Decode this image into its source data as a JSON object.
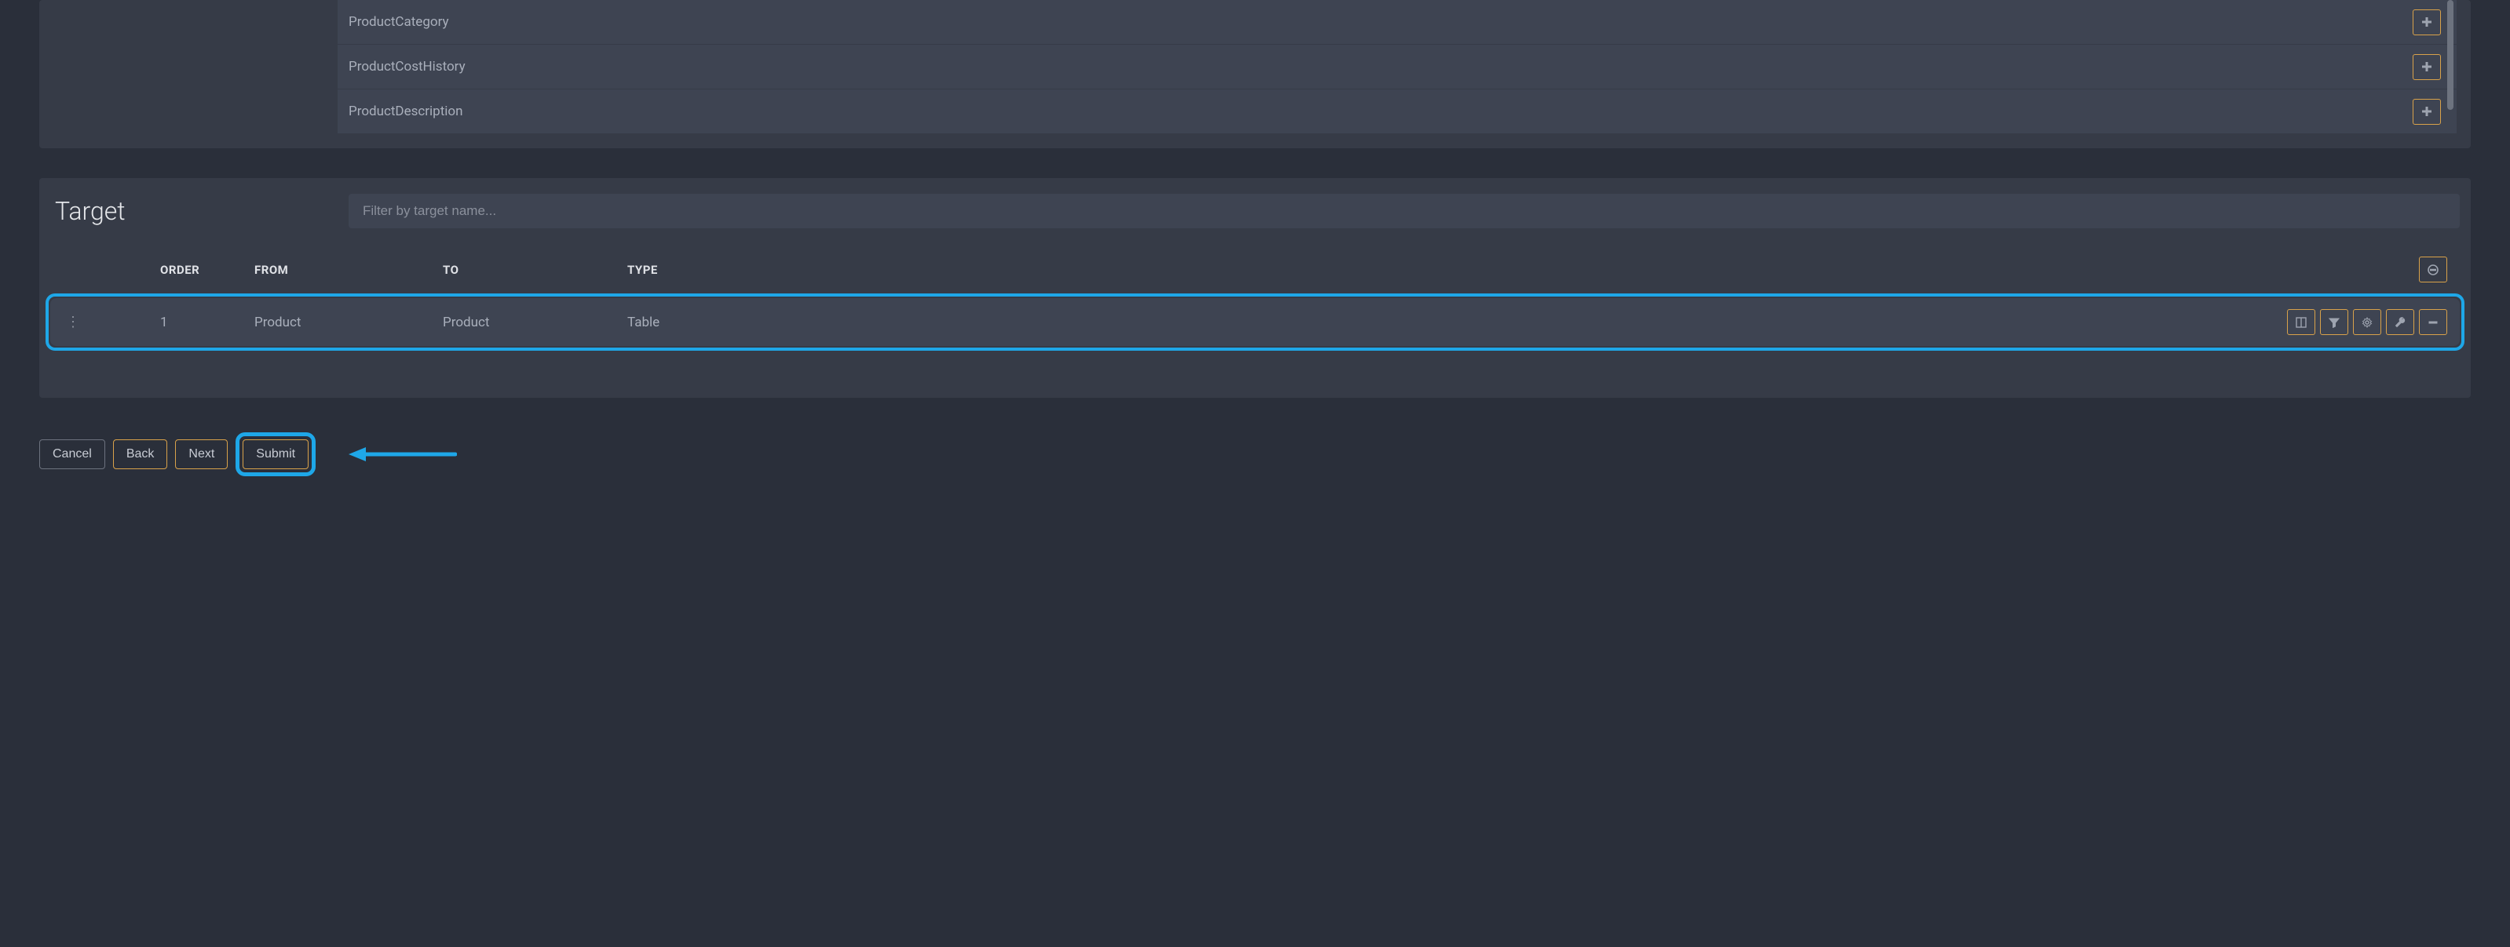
{
  "source": {
    "items": [
      {
        "label": "ProductCategory"
      },
      {
        "label": "ProductCostHistory"
      },
      {
        "label": "ProductDescription"
      }
    ]
  },
  "target": {
    "title": "Target",
    "filter_placeholder": "Filter by target name...",
    "columns": {
      "order": "ORDER",
      "from": "FROM",
      "to": "TO",
      "type": "TYPE"
    },
    "rows": [
      {
        "order": "1",
        "from": "Product",
        "to": "Product",
        "type": "Table"
      }
    ]
  },
  "footer": {
    "cancel": "Cancel",
    "back": "Back",
    "next": "Next",
    "submit": "Submit"
  }
}
